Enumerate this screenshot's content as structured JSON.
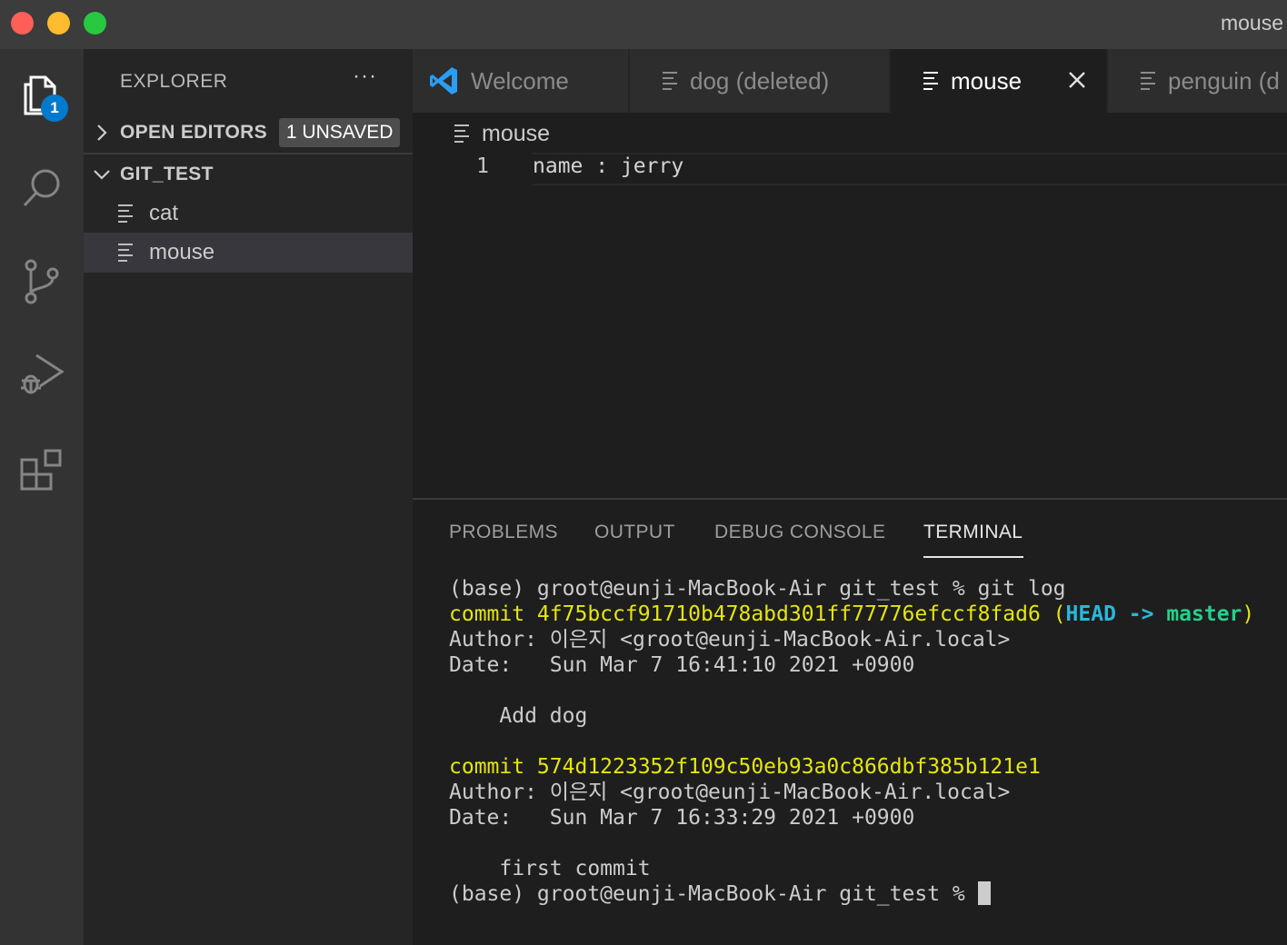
{
  "window": {
    "title": "mouse"
  },
  "activity_bar": {
    "items": [
      {
        "name": "explorer",
        "icon": "files-icon",
        "badge": "1"
      },
      {
        "name": "search",
        "icon": "search-icon"
      },
      {
        "name": "source-control",
        "icon": "source-control-icon"
      },
      {
        "name": "run-debug",
        "icon": "run-debug-icon"
      },
      {
        "name": "extensions",
        "icon": "extensions-icon"
      }
    ]
  },
  "sidebar": {
    "header": "EXPLORER",
    "more": "···",
    "open_editors": {
      "label": "OPEN EDITORS",
      "badge": "1 UNSAVED"
    },
    "folder": {
      "label": "GIT_TEST"
    },
    "files": [
      "cat",
      "mouse"
    ],
    "selected_file": "mouse"
  },
  "tabs": [
    {
      "label": "Welcome",
      "icon": "vscode-logo-icon"
    },
    {
      "label": "dog (deleted)",
      "icon": "file-lines-icon"
    },
    {
      "label": "mouse",
      "icon": "file-lines-icon",
      "active": true
    },
    {
      "label": "penguin (d",
      "icon": "file-lines-icon"
    }
  ],
  "editor": {
    "breadcrumb": "mouse",
    "line_number": "1",
    "line_text": "name : jerry"
  },
  "panel": {
    "tabs": [
      "PROBLEMS",
      "OUTPUT",
      "DEBUG CONSOLE",
      "TERMINAL"
    ],
    "active_tab": "TERMINAL"
  },
  "terminal": {
    "prompt": "(base) groot@eunji-MacBook-Air git_test % ",
    "command": "git log",
    "commit1": "commit 4f75bccf91710b478abd301ff77776efccf8fad6",
    "ref_open": " (",
    "ref_head": "HEAD -> ",
    "ref_branch": "master",
    "ref_close": ")",
    "author1": "Author: 이은지 <groot@eunji-MacBook-Air.local>",
    "date1": "Date:   Sun Mar 7 16:41:10 2021 +0900",
    "msg1": "    Add dog",
    "commit2": "commit 574d1223352f109c50eb93a0c866dbf385b121e1",
    "author2": "Author: 이은지 <groot@eunji-MacBook-Air.local>",
    "date2": "Date:   Sun Mar 7 16:33:29 2021 +0900",
    "msg2": "    first commit",
    "final_prompt": "(base) groot@eunji-MacBook-Air git_test % "
  },
  "colors": {
    "accent": "#007acc",
    "terminal_yellow": "#e5e510",
    "terminal_cyan": "#29b8db",
    "terminal_green": "#23d18b"
  }
}
